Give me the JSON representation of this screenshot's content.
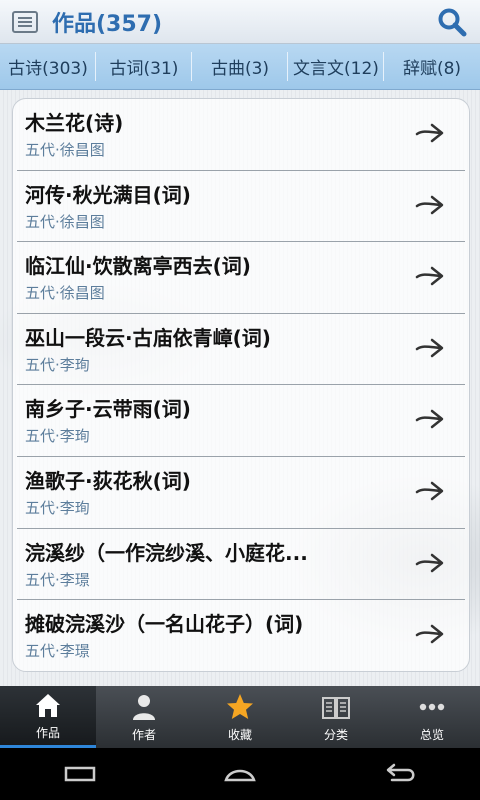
{
  "header": {
    "title": "作品(357)"
  },
  "tabs": [
    {
      "label": "古诗(303)"
    },
    {
      "label": "古词(31)"
    },
    {
      "label": "古曲(3)"
    },
    {
      "label": "文言文(12)"
    },
    {
      "label": "辞赋(8)"
    }
  ],
  "works": [
    {
      "title": "木兰花(诗)",
      "author": "五代·徐昌图"
    },
    {
      "title": "河传·秋光满目(词)",
      "author": "五代·徐昌图"
    },
    {
      "title": "临江仙·饮散离亭西去(词)",
      "author": "五代·徐昌图"
    },
    {
      "title": "巫山一段云·古庙依青嶂(词)",
      "author": "五代·李珣"
    },
    {
      "title": "南乡子·云带雨(词)",
      "author": "五代·李珣"
    },
    {
      "title": "渔歌子·荻花秋(词)",
      "author": "五代·李珣"
    },
    {
      "title": "浣溪纱（一作浣纱溪、小庭花...",
      "author": "五代·李璟"
    },
    {
      "title": "摊破浣溪沙（一名山花子）(词)",
      "author": "五代·李璟"
    }
  ],
  "bottom_nav": [
    {
      "label": "作品",
      "icon": "home-icon",
      "active": true
    },
    {
      "label": "作者",
      "icon": "person-icon",
      "active": false
    },
    {
      "label": "收藏",
      "icon": "star-icon",
      "active": false
    },
    {
      "label": "分类",
      "icon": "book-icon",
      "active": false
    },
    {
      "label": "总览",
      "icon": "more-dots-icon",
      "active": false
    }
  ],
  "colors": {
    "title_blue": "#2e6db0",
    "tab_bg": "#a9d0ee",
    "nav_active": "#2e86d9",
    "star": "#f5a623"
  }
}
